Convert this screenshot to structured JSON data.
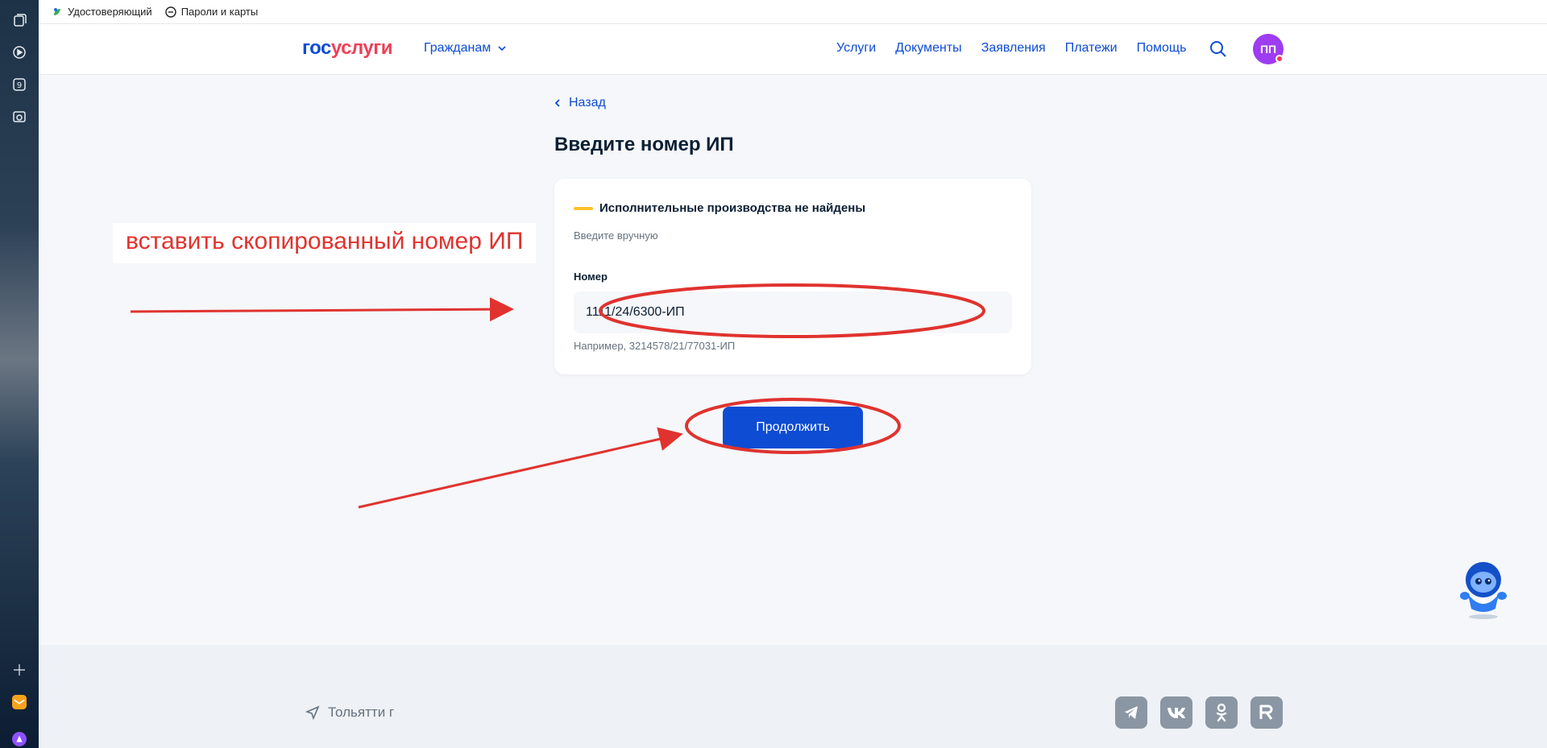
{
  "bookmarks": [
    {
      "label": "Удостоверяющий"
    },
    {
      "label": "Пароли и карты"
    }
  ],
  "header": {
    "logo_part1": "гос",
    "logo_part2": "услуги",
    "audience": "Гражданам",
    "nav": [
      "Услуги",
      "Документы",
      "Заявления",
      "Платежи",
      "Помощь"
    ],
    "avatar_initials": "ПП"
  },
  "main": {
    "back_label": "Назад",
    "title": "Введите номер ИП",
    "status_text": "Исполнительные производства не найдены",
    "manual_hint": "Введите вручную",
    "field_label": "Номер",
    "field_value": "1111/24/6300-ИП",
    "field_example": "Например, 3214578/21/77031-ИП",
    "continue_label": "Продолжить"
  },
  "annotation": {
    "text": "вставить скопированный номер ИП",
    "color": "#e0332f"
  },
  "footer": {
    "location": "Тольятти г",
    "socials": [
      "telegram-icon",
      "vk-icon",
      "ok-icon",
      "rutube-icon"
    ]
  },
  "colors": {
    "primary": "#0d4cd3",
    "accent_red": "#ee3f58",
    "warning": "#fcc02d",
    "avatar": "#9d3cf0"
  }
}
